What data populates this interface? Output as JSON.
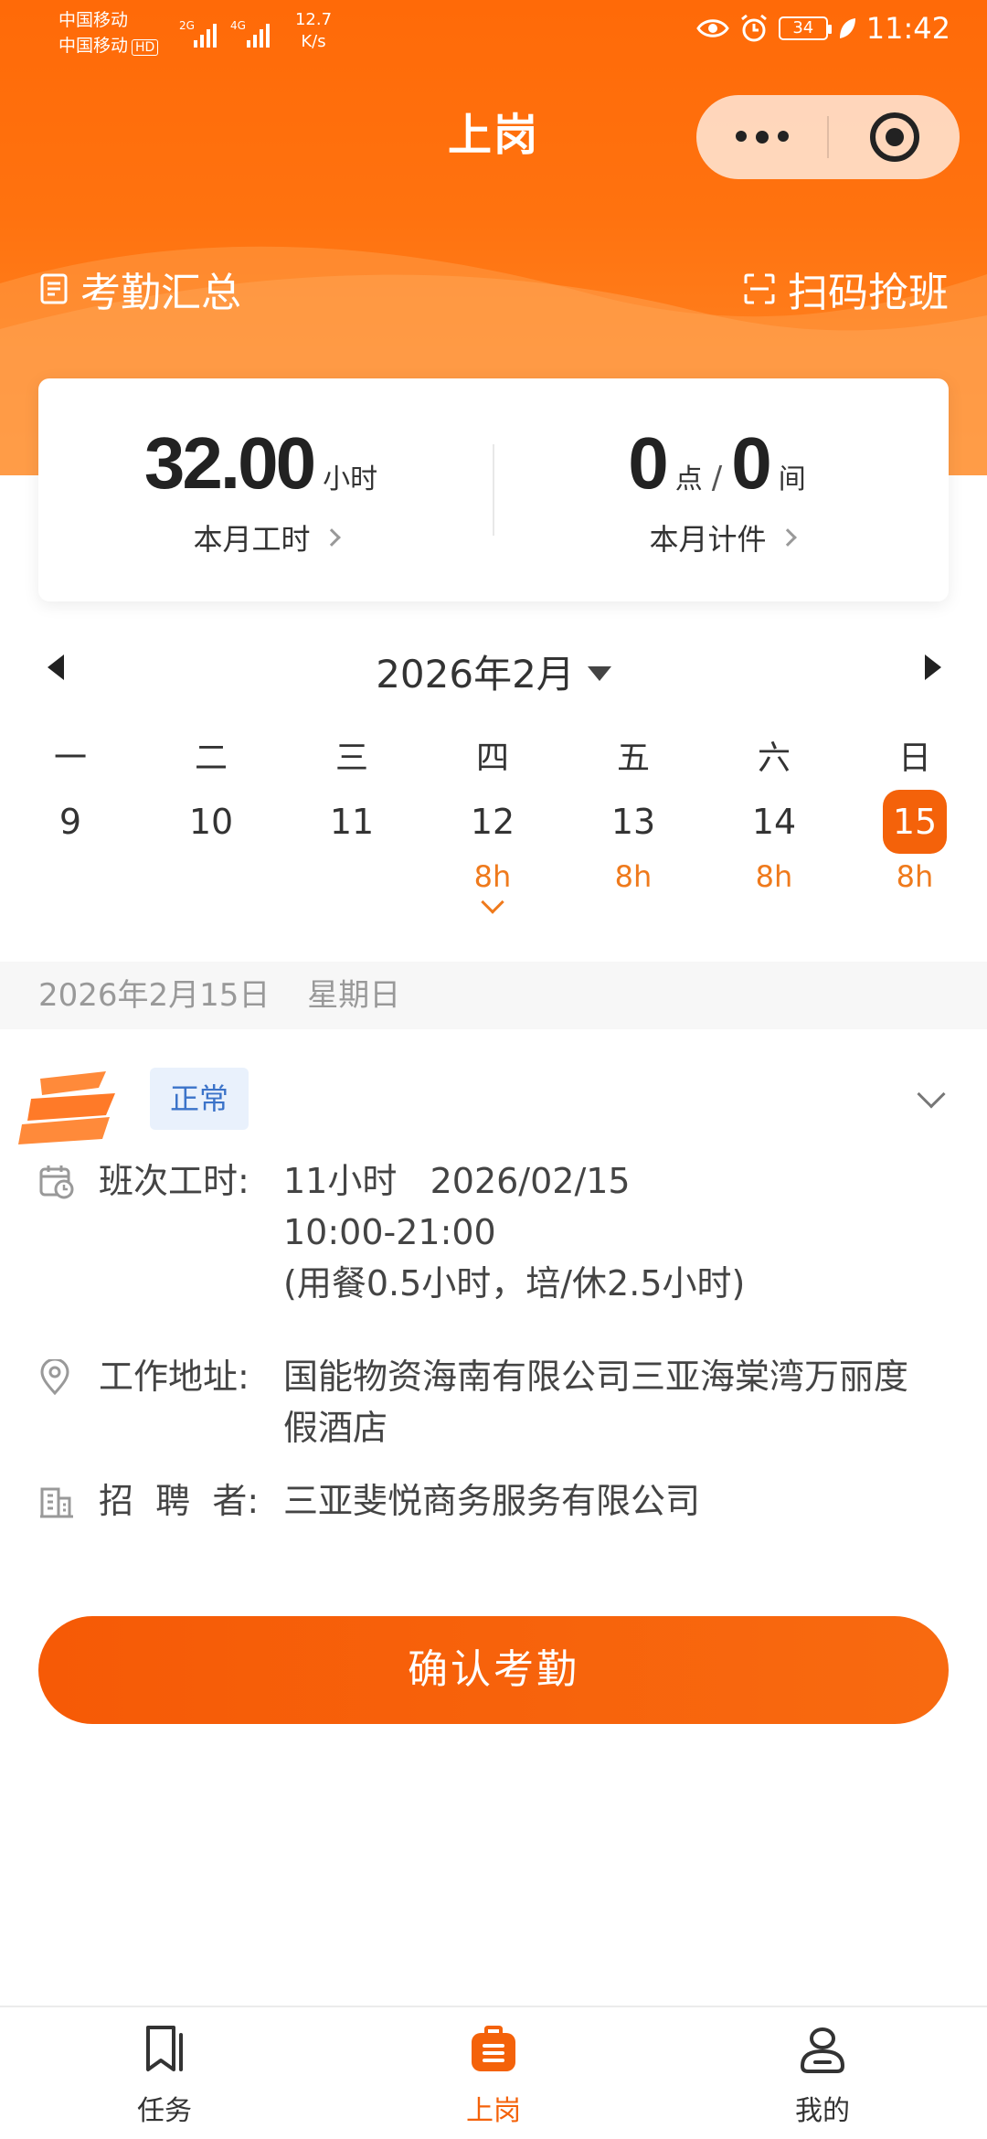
{
  "statusbar": {
    "carrier_1": "中国移动",
    "carrier_2": "中国移动",
    "hd": "HD",
    "net_1": "2G",
    "net_2": "4G",
    "speed_value": "12.7",
    "speed_unit": "K/s",
    "battery": "34",
    "time": "11:42"
  },
  "header": {
    "title": "上岗",
    "left_tool": "考勤汇总",
    "right_tool": "扫码抢班"
  },
  "stats": {
    "hours_value": "32.00",
    "hours_unit": "小时",
    "hours_label": "本月工时",
    "points_value": "0",
    "points_unit": "点",
    "slash": "/",
    "rooms_value": "0",
    "rooms_unit": "间",
    "piece_label": "本月计件"
  },
  "calendar": {
    "month": "2026年2月",
    "days": [
      {
        "weekday": "一",
        "date": "9",
        "hours": ""
      },
      {
        "weekday": "二",
        "date": "10",
        "hours": ""
      },
      {
        "weekday": "三",
        "date": "11",
        "hours": ""
      },
      {
        "weekday": "四",
        "date": "12",
        "hours": "8h"
      },
      {
        "weekday": "五",
        "date": "13",
        "hours": "8h"
      },
      {
        "weekday": "六",
        "date": "14",
        "hours": "8h"
      },
      {
        "weekday": "日",
        "date": "15",
        "hours": "8h"
      }
    ]
  },
  "date_bar": {
    "date": "2026年2月15日",
    "weekday": "星期日"
  },
  "detail": {
    "status": "正常",
    "shift_label": "班次工时:",
    "shift_line1": "11小时   2026/02/15",
    "shift_line2": "10:00-21:00",
    "shift_line3": "(用餐0.5小时，培/休2.5小时)",
    "address_label": "工作地址:",
    "address_value": "国能物资海南有限公司三亚海棠湾万丽度假酒店",
    "recruiter_label": "招  聘  者:",
    "recruiter_value": "三亚斐悦商务服务有限公司"
  },
  "confirm_button": "确认考勤",
  "tabs": [
    {
      "label": "任务"
    },
    {
      "label": "上岗"
    },
    {
      "label": "我的"
    }
  ],
  "colors": {
    "brand": "#f4620a",
    "hours_text": "#ef7a1c",
    "badge_bg": "#e9f1fc",
    "badge_text": "#3b73c9"
  }
}
